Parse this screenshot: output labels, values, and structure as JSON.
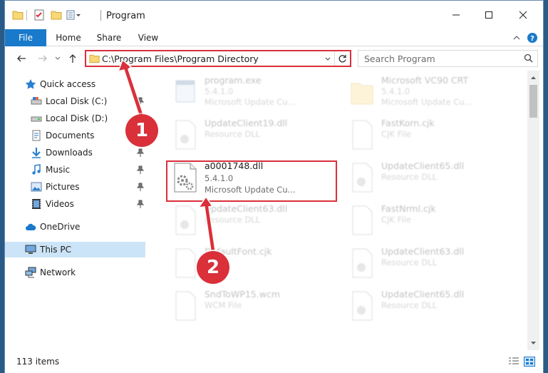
{
  "window": {
    "title": "Program",
    "minimize_icon": "minimize-icon",
    "maximize_icon": "maximize-icon",
    "close_icon": "close-icon"
  },
  "ribbon": {
    "tabs": [
      {
        "label": "File"
      },
      {
        "label": "Home"
      },
      {
        "label": "Share"
      },
      {
        "label": "View"
      }
    ]
  },
  "address": {
    "path": "C:\\Program Files\\Program Directory"
  },
  "search": {
    "placeholder": "Search Program"
  },
  "navpane": {
    "items": [
      {
        "label": "Quick access",
        "icon": "star-icon",
        "pinned": false
      },
      {
        "label": "Local Disk (C:)",
        "icon": "drive-icon",
        "pinned": true
      },
      {
        "label": "Local Disk (D:)",
        "icon": "drive-icon",
        "pinned": false
      },
      {
        "label": "Documents",
        "icon": "documents-icon",
        "pinned": true
      },
      {
        "label": "Downloads",
        "icon": "download-icon",
        "pinned": true
      },
      {
        "label": "Music",
        "icon": "music-icon",
        "pinned": true
      },
      {
        "label": "Pictures",
        "icon": "pictures-icon",
        "pinned": true
      },
      {
        "label": "Videos",
        "icon": "videos-icon",
        "pinned": true
      },
      {
        "label": "OneDrive",
        "icon": "cloud-icon",
        "pinned": false
      },
      {
        "label": "This PC",
        "icon": "computer-icon",
        "pinned": false
      },
      {
        "label": "Network",
        "icon": "network-icon",
        "pinned": false
      }
    ]
  },
  "files": {
    "left": [
      {
        "name": "program.exe",
        "line1": "5.4.1.0",
        "line2": "Microsoft Update Cu..."
      },
      {
        "name": "UpdateClient19.dll",
        "line1": "Resource DLL",
        "line2": ""
      },
      {
        "name": "a0001748.dll",
        "line1": "5.4.1.0",
        "line2": "Microsoft Update Cu..."
      },
      {
        "name": "UpdateClient63.dll",
        "line1": "Resource DLL",
        "line2": ""
      },
      {
        "name": "DefaultFont.cjk",
        "line1": "",
        "line2": ""
      },
      {
        "name": "SndToWP15.wcm",
        "line1": "WCM File",
        "line2": ""
      }
    ],
    "right": [
      {
        "name": "Microsoft VC90 CRT",
        "line1": "5.4.1.0",
        "line2": "Microsoft Update Cu..."
      },
      {
        "name": "FastKorn.cjk",
        "line1": "CJK File",
        "line2": ""
      },
      {
        "name": "UpdateClient65.dll",
        "line1": "Resource DLL",
        "line2": ""
      },
      {
        "name": "FastNrml.cjk",
        "line1": "CJK File",
        "line2": ""
      },
      {
        "name": "UpdateClient63.dll",
        "line1": "Resource DLL",
        "line2": ""
      },
      {
        "name": "UpdateClient65.dll",
        "line1": "Resource DLL",
        "line2": ""
      }
    ]
  },
  "status": {
    "count": "113 items"
  },
  "callouts": {
    "one": "1",
    "two": "2"
  },
  "colors": {
    "accent": "#1979ca",
    "highlight": "#d9303a",
    "selected": "#cce4f7"
  }
}
